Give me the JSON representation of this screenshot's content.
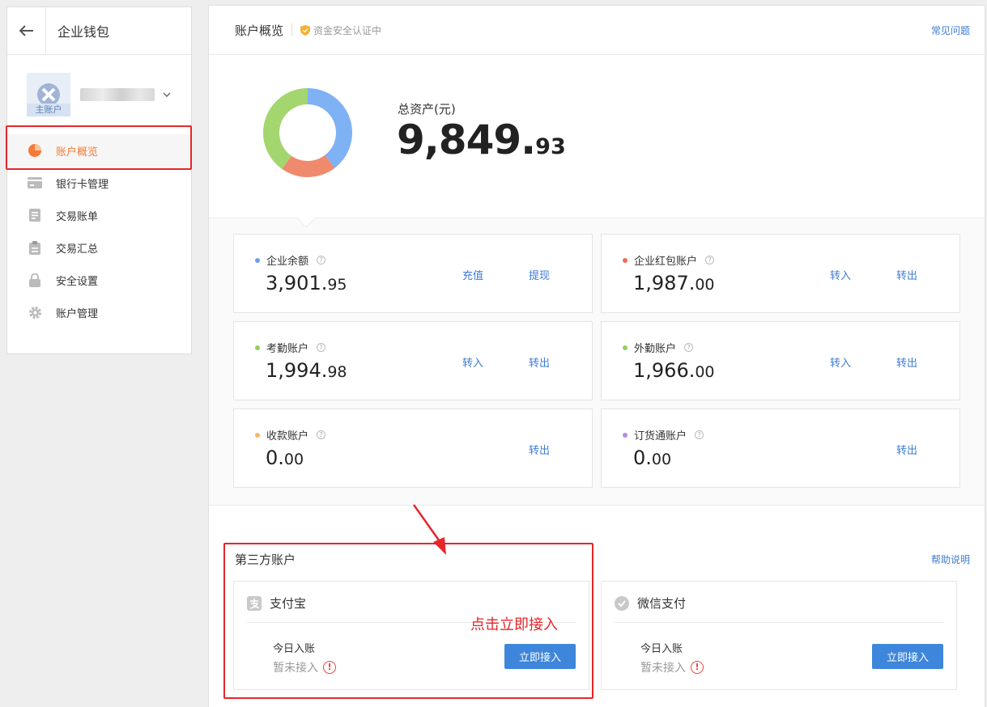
{
  "sidebar": {
    "back_icon": "arrow-left-icon",
    "title": "企业钱包",
    "account_badge": "主账户",
    "nav": [
      {
        "label": "账户概览",
        "icon": "pie-chart-icon",
        "active": true
      },
      {
        "label": "银行卡管理",
        "icon": "card-icon"
      },
      {
        "label": "交易账单",
        "icon": "bill-icon"
      },
      {
        "label": "交易汇总",
        "icon": "clipboard-icon"
      },
      {
        "label": "安全设置",
        "icon": "lock-icon"
      },
      {
        "label": "账户管理",
        "icon": "gear-icon"
      }
    ]
  },
  "header": {
    "title": "账户概览",
    "secure_text": "资金安全认证中",
    "faq": "常见问题"
  },
  "summary": {
    "total_label": "总资产(元)",
    "total_int": "9,849.",
    "total_dec": "93"
  },
  "chart_data": {
    "type": "pie",
    "categories": [
      "企业余额",
      "企业红包账户",
      "考勤账户",
      "外勤账户",
      "收款账户",
      "订货通账户"
    ],
    "values": [
      3901.95,
      1987.0,
      1994.98,
      1966.0,
      0.0,
      0.0
    ],
    "colors": [
      "#7fb1f5",
      "#ef8a6d",
      "#a3d66e",
      "#a3d66e",
      "#f5b66b",
      "#b48be2"
    ]
  },
  "accounts": [
    {
      "name": "企业余额",
      "int": "3,901.",
      "dec": "95",
      "color": "#6f9ded",
      "actions": [
        "充值",
        "提现"
      ]
    },
    {
      "name": "企业红包账户",
      "int": "1,987.",
      "dec": "00",
      "color": "#e96c5e",
      "actions": [
        "转入",
        "转出"
      ]
    },
    {
      "name": "考勤账户",
      "int": "1,994.",
      "dec": "98",
      "color": "#8fd05f",
      "actions": [
        "转入",
        "转出"
      ]
    },
    {
      "name": "外勤账户",
      "int": "1,966.",
      "dec": "00",
      "color": "#8fd05f",
      "actions": [
        "转入",
        "转出"
      ]
    },
    {
      "name": "收款账户",
      "int": "0.",
      "dec": "00",
      "color": "#f5b66b",
      "actions": [
        "转出"
      ]
    },
    {
      "name": "订货通账户",
      "int": "0.",
      "dec": "00",
      "color": "#b48be2",
      "actions": [
        "转出"
      ]
    }
  ],
  "third_party": {
    "title": "第三方账户",
    "help": "帮助说明",
    "providers": [
      {
        "name": "支付宝",
        "icon": "alipay-icon",
        "today_label": "今日入账",
        "status": "暂未接入",
        "button": "立即接入"
      },
      {
        "name": "微信支付",
        "icon": "wechat-pay-icon",
        "today_label": "今日入账",
        "status": "暂未接入",
        "button": "立即接入"
      }
    ]
  },
  "annotation": {
    "text": "点击立即接入",
    "color": "#e6262a"
  }
}
